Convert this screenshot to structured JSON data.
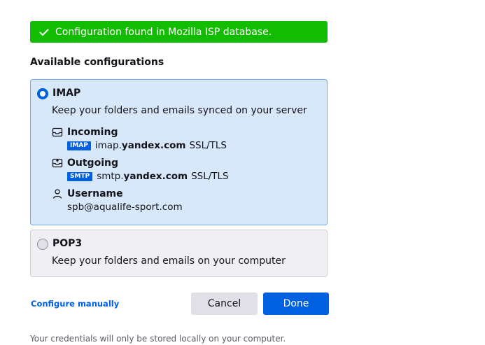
{
  "banner": {
    "text": "Configuration found in Mozilla ISP database.",
    "color": "#12bc00"
  },
  "section_title": "Available configurations",
  "configs": [
    {
      "protocol": "IMAP",
      "selected": true,
      "description": "Keep your folders and emails synced on your server",
      "incoming": {
        "label": "Incoming",
        "tag": "IMAP",
        "host_prefix": "imap.",
        "host_domain": "yandex.com",
        "security": "SSL/TLS"
      },
      "outgoing": {
        "label": "Outgoing",
        "tag": "SMTP",
        "host_prefix": "smtp.",
        "host_domain": "yandex.com",
        "security": "SSL/TLS"
      },
      "username": {
        "label": "Username",
        "value": "spb@aqualife-sport.com"
      }
    },
    {
      "protocol": "POP3",
      "selected": false,
      "description": "Keep your folders and emails on your computer"
    }
  ],
  "actions": {
    "configure_manually": "Configure manually",
    "cancel": "Cancel",
    "done": "Done"
  },
  "footer_note": "Your credentials will only be stored locally on your computer.",
  "colors": {
    "accent": "#0061e0",
    "success": "#12bc00",
    "selected_bg": "#d8e8fb"
  }
}
